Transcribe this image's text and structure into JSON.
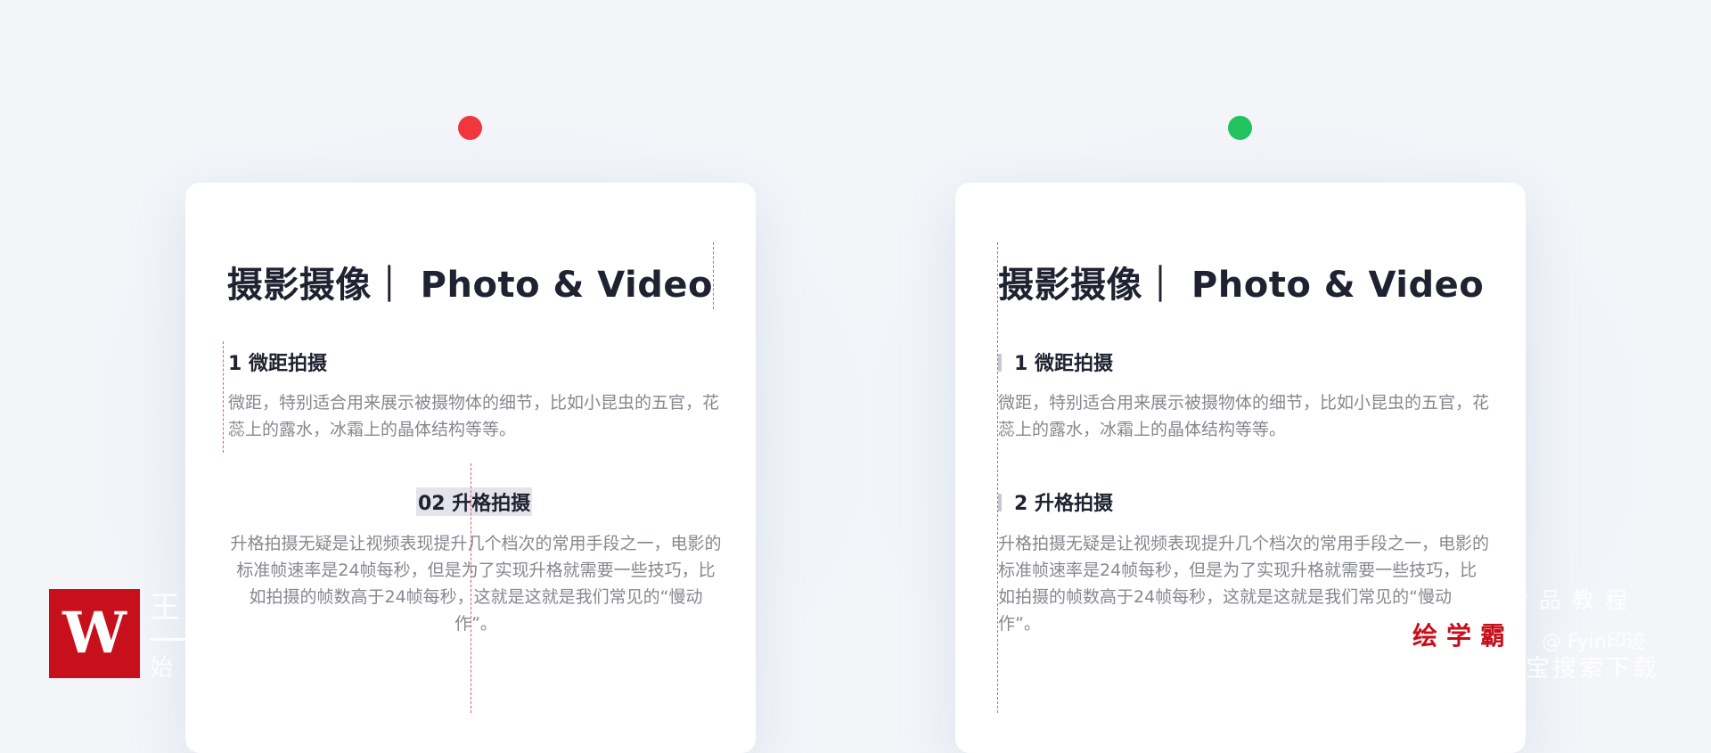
{
  "colors": {
    "background": "#f3f5f9",
    "card": "#ffffff",
    "dot_wrong": "#f0373b",
    "dot_right": "#22c25e",
    "guide_line": "#ee5561",
    "title_text": "#1f2230",
    "body_text": "#86888f",
    "watermark_red": "#c8101d"
  },
  "cards": [
    {
      "indicator": "red",
      "title": "摄影摄像｜ Photo & Video",
      "section1": {
        "heading": "1 微距拍摄",
        "body": "微距，特别适合用来展示被摄物体的细节，比如小昆虫的五官，花蕊上的露水，冰霜上的晶体结构等等。"
      },
      "section2": {
        "heading": "02 升格拍摄",
        "body": "升格拍摄无疑是让视频表现提升几个档次的常用手段之一，电影的标准帧速率是24帧每秒，但是为了实现升格就需要一些技巧，比如拍摄的帧数高于24帧每秒，这就是这就是我们常见的“慢动作”。"
      }
    },
    {
      "indicator": "green",
      "title": "摄影摄像｜ Photo & Video",
      "section1": {
        "heading": "1 微距拍摄",
        "body": "微距，特别适合用来展示被摄物体的细节，比如小昆虫的五官，花蕊上的露水，冰霜上的晶体结构等等。"
      },
      "section2": {
        "heading": "2 升格拍摄",
        "body": "升格拍摄无疑是让视频表现提升几个档次的常用手段之一，电影的标准帧速率是24帧每秒，但是为了实现升格就需要一些技巧，比如拍摄的帧数高于24帧每秒，这就是这就是我们常见的“慢动作”。"
      }
    }
  ],
  "watermark": {
    "logo_letter": "W",
    "left_top": "王",
    "left_bottom": "始",
    "right_top": "精品教程",
    "brand": "绘学霸",
    "handle": "@ Fyin印迹",
    "right_bottom": "宝搜索下载"
  }
}
